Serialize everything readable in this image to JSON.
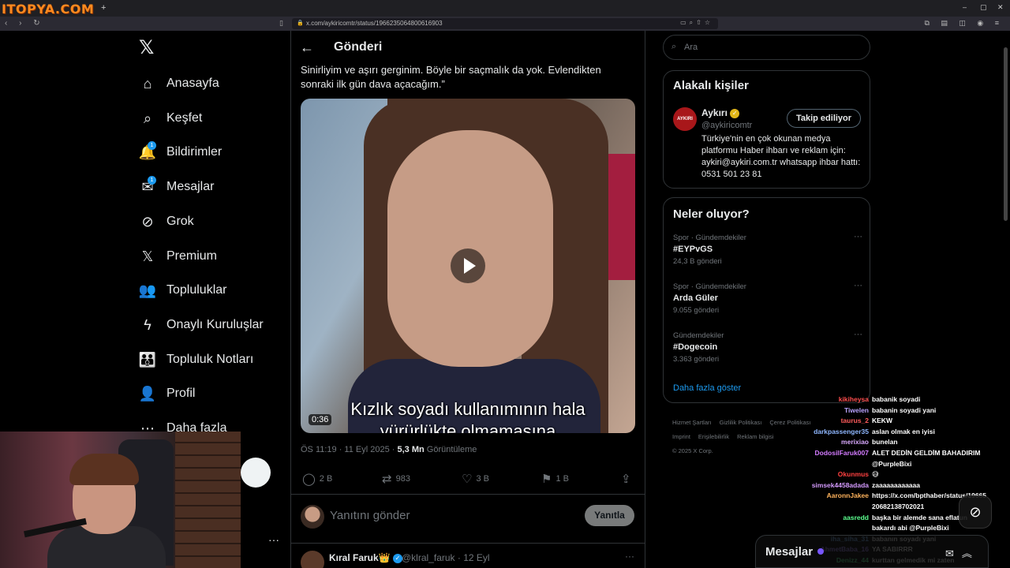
{
  "browser": {
    "watermark": "ITOPYA.COM",
    "new_tab": "+",
    "url": "x.com/aykiricomtr/status/1966235064800616903",
    "window_controls": [
      "–",
      "▢",
      "✕"
    ]
  },
  "nav": {
    "items": [
      {
        "label": "Anasayfa",
        "icon": "home-icon"
      },
      {
        "label": "Keşfet",
        "icon": "search-icon"
      },
      {
        "label": "Bildirimler",
        "icon": "bell-icon",
        "badge": "1"
      },
      {
        "label": "Mesajlar",
        "icon": "mail-icon",
        "badge": "1"
      },
      {
        "label": "Grok",
        "icon": "grok-icon"
      },
      {
        "label": "Premium",
        "icon": "x-icon"
      },
      {
        "label": "Topluluklar",
        "icon": "communities-icon"
      },
      {
        "label": "Onaylı Kuruluşlar",
        "icon": "lightning-icon"
      },
      {
        "label": "Topluluk Notları",
        "icon": "community-notes-icon"
      },
      {
        "label": "Profil",
        "icon": "profile-icon"
      },
      {
        "label": "Daha fazla",
        "icon": "more-circle-icon"
      }
    ]
  },
  "post": {
    "page_title": "Gönderi",
    "text": "Sinirliyim ve aşırı gerginim. Böyle bir saçmalık da yok. Evlendikten sonraki ilk gün dava açacağım.”",
    "video_subtitle": "Kızlık soyadı kullanımının hala\nyürürlükte olmamasına",
    "video_duration": "0:36",
    "time": "ÖS 11:19 · 11 Eyl 2025 · ",
    "views": "5,3 Mn",
    "views_label": " Görüntüleme",
    "replies": "2 B",
    "reposts": "983",
    "likes": "3 B",
    "bookmarks": "1 B",
    "reply_placeholder": "Yanıtını gönder",
    "reply_button": "Yanıtla",
    "next_reply_name": "Kıral Faruk👑",
    "next_reply_handle": "@klral_faruk · 12 Eyl"
  },
  "right": {
    "search_placeholder": "Ara",
    "related": {
      "title": "Alakalı kişiler",
      "avatar_text": "AYKIRI",
      "name": "Aykırı",
      "handle": "@aykiricomtr",
      "follow_label": "Takip ediliyor",
      "bio": "Türkiye'nin en çok okunan medya platformu Haber ihbarı ve reklam için: aykiri@aykiri.com.tr whatsapp ihbar hattı: 0531 501 23 81"
    },
    "trends": {
      "title": "Neler oluyor?",
      "items": [
        {
          "category": "Spor · Gündemdekiler",
          "name": "#EYPvGS",
          "posts": "24,3 B gönderi"
        },
        {
          "category": "Spor · Gündemdekiler",
          "name": "Arda Güler",
          "posts": "9.055 gönderi"
        },
        {
          "category": "Gündemdekiler",
          "name": "#Dogecoin",
          "posts": "3.363 gönderi"
        }
      ],
      "show_more": "Daha fazla göster"
    },
    "footer": [
      "Hizmet Şartları",
      "Gizlilik Politikası",
      "Çerez Politikası",
      "Imprint",
      "Erişilebilirlik",
      "Reklam bilgisi",
      "© 2025 X Corp."
    ]
  },
  "chat": [
    {
      "user": "kikiheysa",
      "msg": "babanik soyadi",
      "color": "#ff4d4d"
    },
    {
      "user": "Tiwelen",
      "msg": "babanin soyadi yani",
      "color": "#b9a3ff"
    },
    {
      "user": "taurus_2",
      "msg": "KEKW",
      "color": "#ff5c5c"
    },
    {
      "user": "darkpassenger35",
      "msg": "aslan olmak en iyisi",
      "color": "#8fb7ff"
    },
    {
      "user": "merixiao",
      "msg": "bunelan",
      "color": "#d9a9ff"
    },
    {
      "user": "DodosilFaruk007",
      "msg": "ALET DEDİN GELDİM BAHADIRIM",
      "color": "#d37bff"
    },
    {
      "user": "",
      "msg": "@PurpleBixi",
      "color": "#ffffff"
    },
    {
      "user": "Okunmus",
      "msg": "😅",
      "color": "#ff4040"
    },
    {
      "user": "simsek4458adada",
      "msg": "zaaaaaaaaaaaa",
      "color": "#d59bff"
    },
    {
      "user": "AaronnJakee",
      "msg": "https://x.com/bpthaber/status/19665",
      "color": "#ffb35c"
    },
    {
      "user": "",
      "msg": "20682138702021",
      "color": "#ffffff"
    },
    {
      "user": "aasredd",
      "msg": "başka bir alemde sana eflatun",
      "color": "#5cff8f"
    },
    {
      "user": "",
      "msg": "bakardı abi @PurpleBixi",
      "color": "#ffffff"
    },
    {
      "user": "iha_siha_31",
      "msg": "babanın soyadı yani",
      "color": "#7ab8ff"
    },
    {
      "user": "AhmetBaba_16",
      "msg": "YA SABIRRR",
      "color": "#a98bff"
    },
    {
      "user": "Denizz_44",
      "msg": "kurttan gelmedik mi zaten",
      "color": "#5cff9a"
    }
  ],
  "messages_panel": {
    "title": "Mesajlar"
  }
}
